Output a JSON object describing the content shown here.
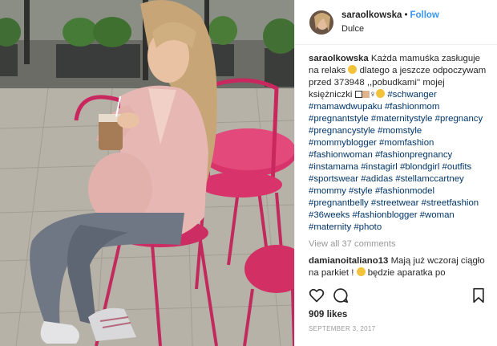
{
  "post": {
    "username": "saraolkowska",
    "separator": "•",
    "follow_label": "Follow",
    "location": "Dulce",
    "caption": {
      "user": "saraolkowska",
      "text_1": "Każda mamuśka zasługuje na relaks",
      "text_2": "dlatego a jeszcze odpoczywam przed 373948 ,,pobudkami'' mojej księżniczki",
      "hashtags": "#schwanger #mamawdwupaku #fashionmom #pregnantstyle #maternitystyle #pregnancy #pregnancystyle #momstyle #mommyblogger #momfashion #fashionwoman #fashionpregnancy #instamama #instagirl #blondgirl #outfits #sportswear #adidas #stellamccartney #mommy #style #fashionmodel #pregnantbelly #streetwear #streetfashion #36weeks #fashionblogger #woman #maternity #photo"
    },
    "view_all": "View all 37 comments",
    "comment": {
      "user": "damianoitaliano13",
      "text_1": "Mają już wczoraj ciągło na parkiet !",
      "text_2": "będzie aparatka po"
    },
    "likes": "909 likes",
    "date": "SEPTEMBER 3, 2017",
    "icons": [
      "heart-icon",
      "comment-icon",
      "bookmark-icon"
    ],
    "colors": {
      "link": "#3897f0",
      "hashtag": "#003569",
      "muted": "#999999"
    }
  }
}
